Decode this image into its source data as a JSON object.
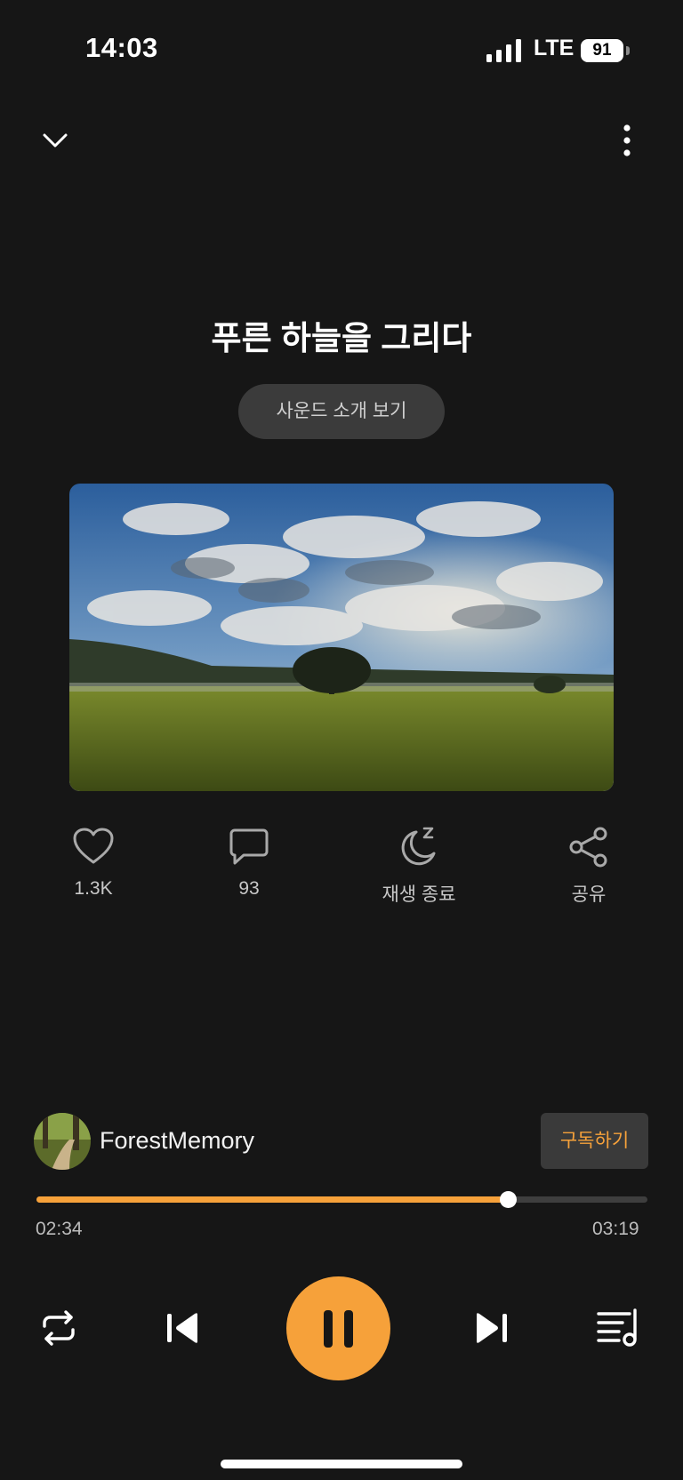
{
  "status_bar": {
    "time": "14:03",
    "network": "LTE",
    "battery": "91"
  },
  "track": {
    "title": "푸른 하늘을 그리다",
    "intro_label": "사운드 소개 보기"
  },
  "actions": {
    "likes": "1.3K",
    "comments": "93",
    "sleep_timer": "재생 종료",
    "share": "공유"
  },
  "creator": {
    "name": "ForestMemory",
    "subscribe_label": "구독하기"
  },
  "playback": {
    "current_time": "02:34",
    "total_time": "03:19",
    "progress_fraction": 0.772,
    "state": "playing"
  },
  "colors": {
    "accent": "#f6a13a",
    "background": "#161616",
    "surface": "#3b3b3b"
  },
  "icons": [
    "chevron-down-icon",
    "more-vertical-icon",
    "heart-icon",
    "comment-icon",
    "moon-sleep-icon",
    "share-icon",
    "repeat-icon",
    "skip-previous-icon",
    "pause-icon",
    "skip-next-icon",
    "playlist-icon"
  ]
}
